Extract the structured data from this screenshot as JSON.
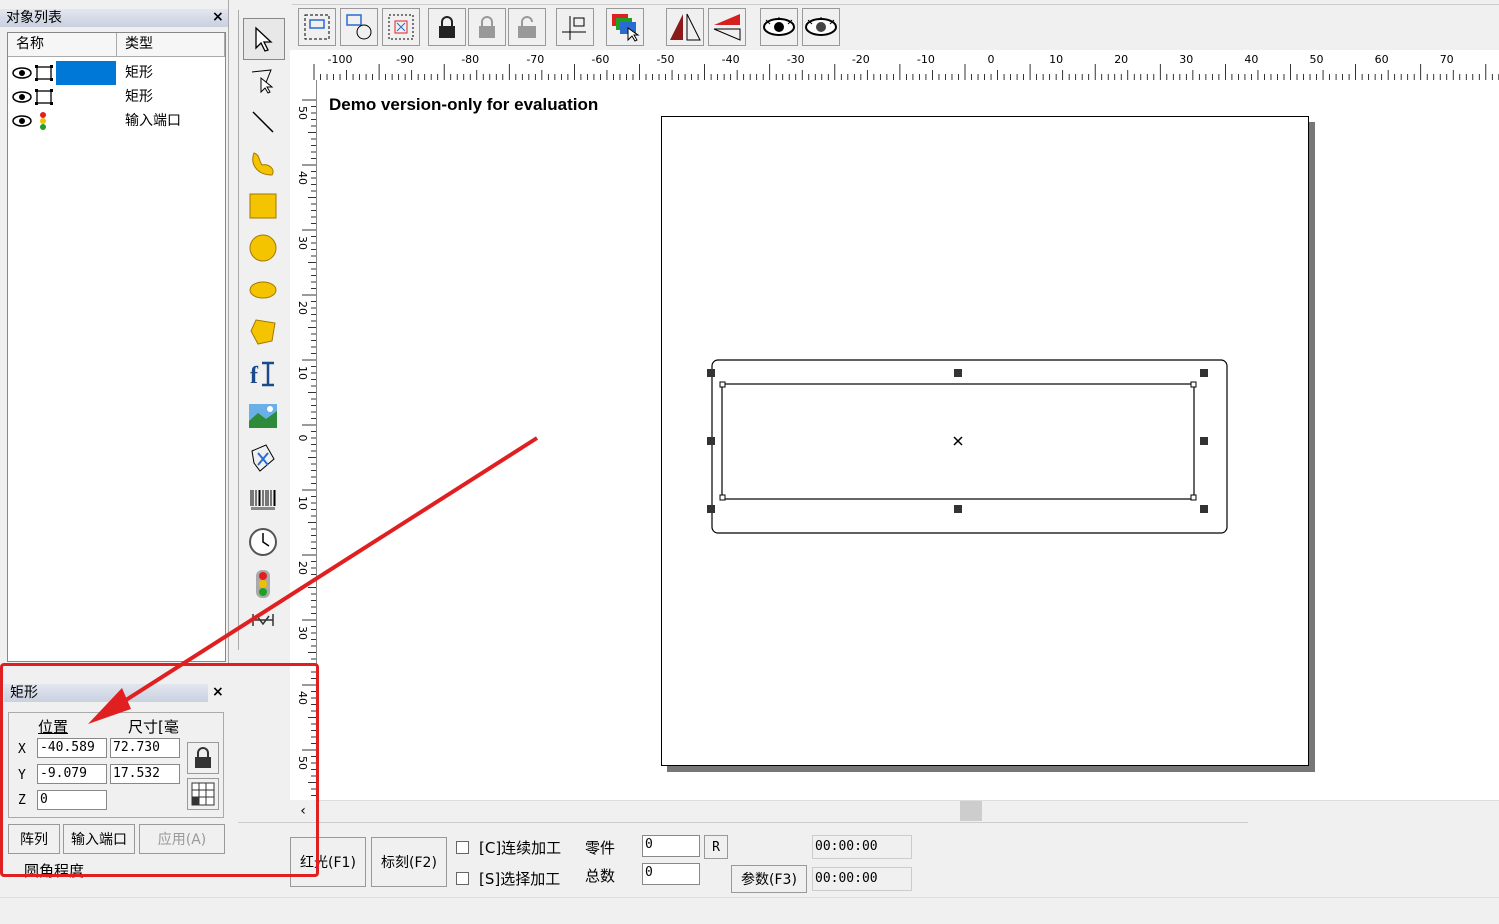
{
  "object_list": {
    "title": "对象列表",
    "close": "×",
    "headers": {
      "name": "名称",
      "type": "类型"
    },
    "rows": [
      {
        "name": "",
        "type": "矩形",
        "icon": "rectangle-icon"
      },
      {
        "name": "",
        "type": "矩形",
        "icon": "rectangle-icon"
      },
      {
        "name": "",
        "type": "输入端口",
        "icon": "traffic-light-icon"
      }
    ]
  },
  "props": {
    "title": "矩形",
    "close": "×",
    "pos_header": "位置",
    "size_header": "尺寸[毫",
    "x_label": "X",
    "y_label": "Y",
    "z_label": "Z",
    "x_pos": "-40.589",
    "y_pos": "-9.079",
    "z_pos": "0",
    "x_size": "72.730",
    "y_size": "17.532",
    "array_btn": "阵列",
    "input_btn": "输入端口",
    "apply_btn": "应用(A)",
    "corner_label": "圆角程度"
  },
  "canvas": {
    "demo_text": "Demo version-only for evaluation",
    "h_ticks": [
      "-100",
      "-90",
      "-80",
      "-70",
      "-60",
      "-50",
      "-40",
      "-30",
      "-20",
      "-10",
      "0",
      "10",
      "20",
      "30",
      "40",
      "50",
      "60",
      "70"
    ],
    "v_ticks": [
      "50",
      "40",
      "30",
      "20",
      "10",
      "0",
      "10",
      "20",
      "30",
      "40",
      "50"
    ]
  },
  "bottom": {
    "red_btn": "红光(F1)",
    "mark_btn": "标刻(F2)",
    "continuous": "[C]连续加工",
    "select": "[S]选择加工",
    "parts_label": "零件",
    "total_label": "总数",
    "parts_value": "0",
    "total_value": "0",
    "r_btn": "R",
    "params_btn": "参数(F3)",
    "time1": "00:00:00",
    "time2": "00:00:00"
  },
  "annotation_color": "#e02020"
}
